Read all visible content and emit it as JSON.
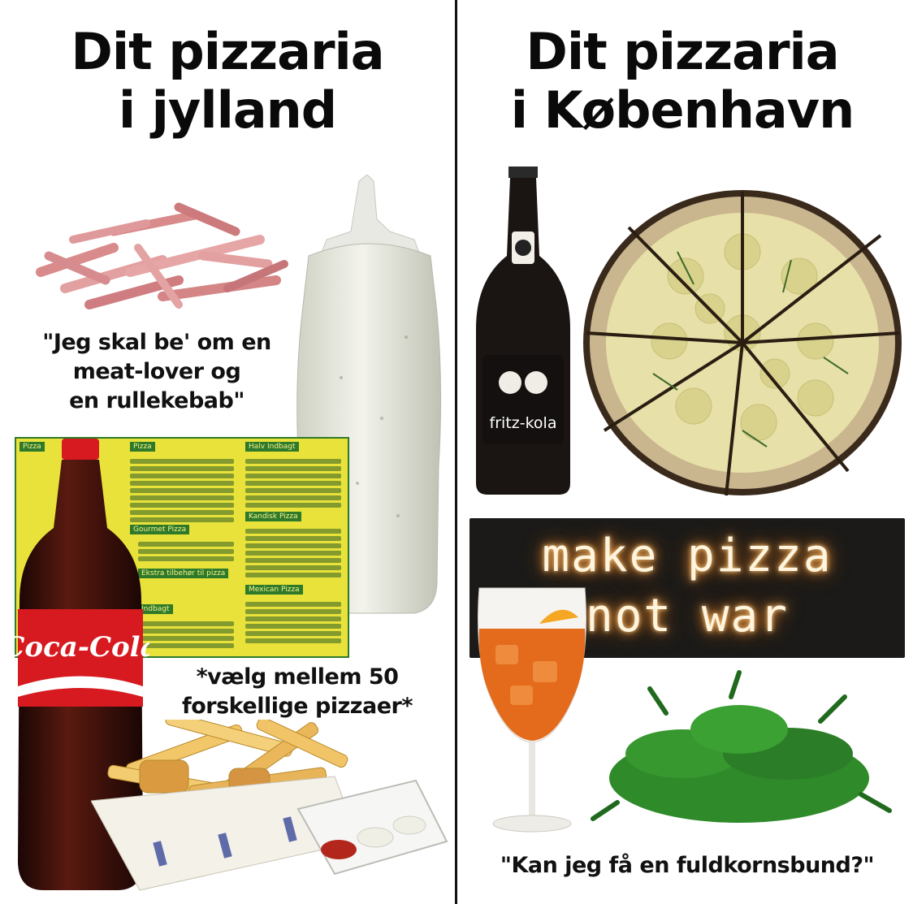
{
  "left": {
    "title_line1": "Dit pizzaria",
    "title_line2": "i jylland",
    "caption_order": [
      "\"Jeg skal be' om en",
      "meat-lover og",
      "en rullekebab\""
    ],
    "caption_menu": [
      "*vælg mellem 50",
      "forskellige pizzaer*"
    ],
    "cola_logo": "Coca-Cola",
    "menu_headers": [
      "Pizza",
      "Pizza",
      "Halv Indbagt",
      "Gourmet Pizza",
      "Kandisk Pizza",
      "Ekstra tilbehør til pizza",
      "Mexican Pizza",
      "Indbagt"
    ]
  },
  "right": {
    "title_line1": "Dit pizzaria",
    "title_line2": "i København",
    "bottle_label": "fritz-kola",
    "neon_line1": "make pizza",
    "neon_line2": "not war",
    "caption_question": "\"Kan jeg få en fuldkornsbund?\""
  },
  "colors": {
    "divider": "#111111",
    "menu_yellow": "#e8e23a",
    "menu_green": "#2f7a2a",
    "cola_red": "#d71920",
    "neon": "#ffcf86"
  }
}
